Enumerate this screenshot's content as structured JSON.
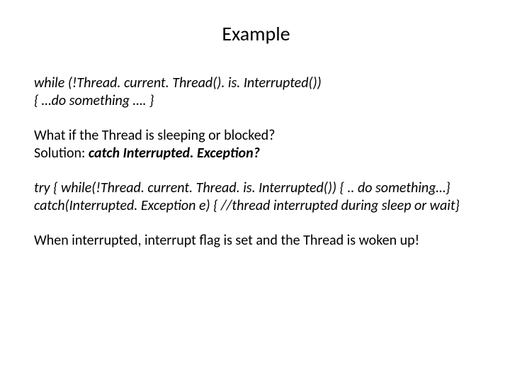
{
  "title": "Example",
  "code1_line1": "while (!Thread. current. Thread(). is. Interrupted())",
  "code1_line2": "{ …do something …. }",
  "q_line1": "What if the Thread is sleeping or blocked?",
  "q_line2_prefix": "Solution: ",
  "q_line2_em": "catch Interrupted. Exception? ",
  "code2_line1": "try { while(!Thread. current. Thread. is. Interrupted()) { .. do something…}",
  "code2_line2": "catch(Interrupted. Exception e) { //thread interrupted during sleep or wait}",
  "final_line": "When interrupted, interrupt flag is set and the Thread is woken up!"
}
